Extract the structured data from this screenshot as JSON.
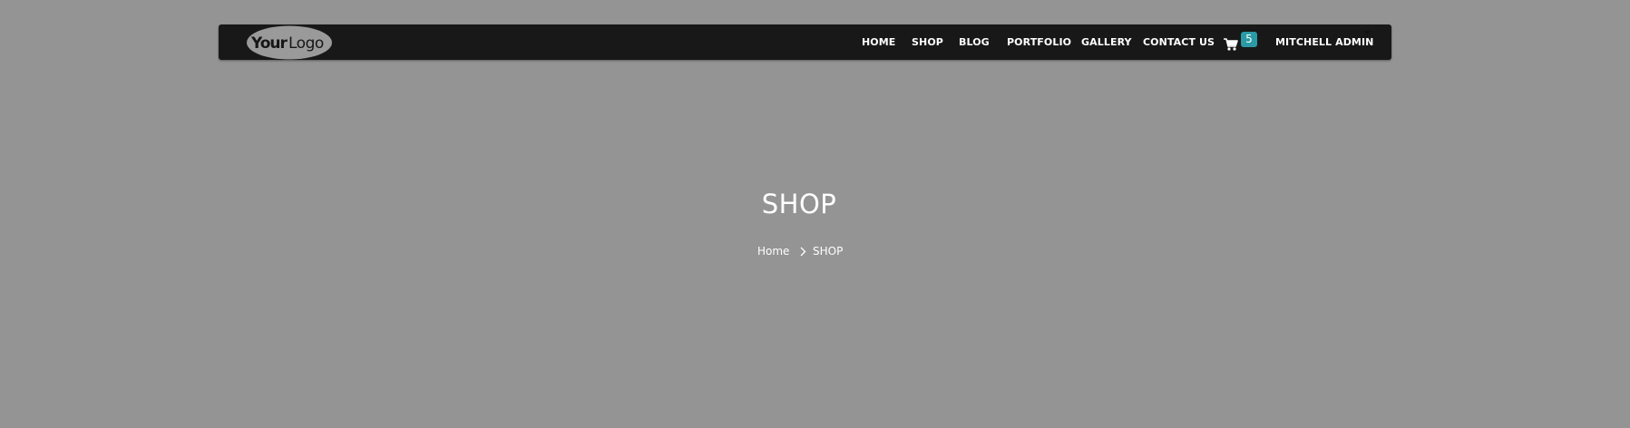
{
  "logo": {
    "text_your": "Your",
    "text_logo": "Logo"
  },
  "nav": {
    "items": [
      {
        "label": "HOME"
      },
      {
        "label": "SHOP"
      },
      {
        "label": "BLOG"
      },
      {
        "label": "PORTFOLIO"
      },
      {
        "label": "GALLERY"
      },
      {
        "label": "CONTACT US"
      }
    ],
    "cart_count": "5",
    "user_name": "MITCHELL ADMIN"
  },
  "hero": {
    "title": "SHOP"
  },
  "breadcrumb": {
    "home": "Home",
    "current": "SHOP"
  },
  "colors": {
    "page_background": "#949494",
    "navbar_background": "#181818",
    "badge": "#2a9aa6",
    "text": "#ffffff"
  },
  "icons": {
    "cart": "shopping-cart-icon",
    "separator": "chevron-right-icon",
    "user_menu": "caret-down-icon"
  }
}
